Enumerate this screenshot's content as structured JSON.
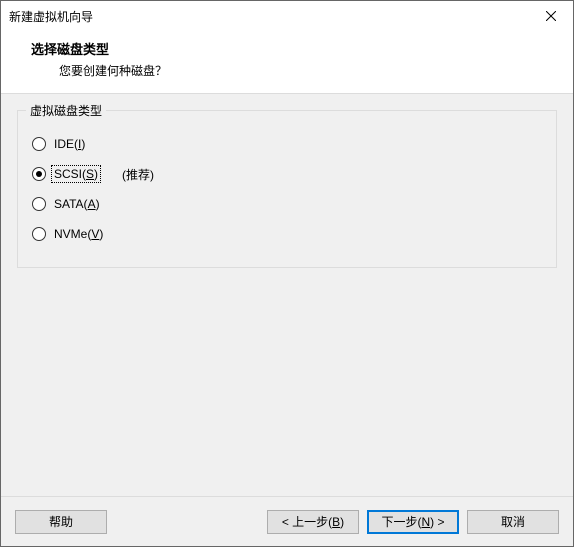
{
  "window": {
    "title": "新建虚拟机向导"
  },
  "header": {
    "title": "选择磁盘类型",
    "subtitle": "您要创建何种磁盘？"
  },
  "group": {
    "legend": "虚拟磁盘类型",
    "recommended_label": "(推荐)"
  },
  "options": {
    "ide": {
      "label_prefix": "IDE(",
      "accel": "I",
      "label_suffix": ")"
    },
    "scsi": {
      "label_prefix": "SCSI(",
      "accel": "S",
      "label_suffix": ")"
    },
    "sata": {
      "label_prefix": "SATA(",
      "accel": "A",
      "label_suffix": ")"
    },
    "nvme": {
      "label_prefix": "NVMe(",
      "accel": "V",
      "label_suffix": ")"
    },
    "selected": "scsi"
  },
  "buttons": {
    "help": "帮助",
    "back": {
      "prefix": "< 上一步(",
      "accel": "B",
      "suffix": ")"
    },
    "next": {
      "prefix": "下一步(",
      "accel": "N",
      "suffix": ") >"
    },
    "cancel": "取消"
  }
}
